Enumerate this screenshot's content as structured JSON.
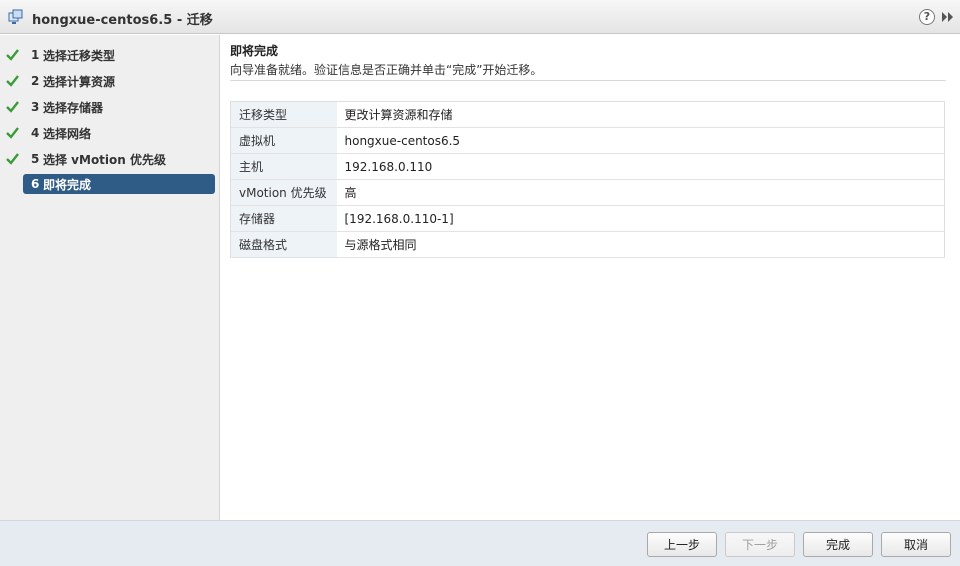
{
  "window": {
    "title": "hongxue-centos6.5 - 迁移",
    "title_icon": "vm-migrate-icon",
    "help_label": "?",
    "help_icon": "help-icon",
    "expand_icon": "double-chevron-right-icon"
  },
  "steps": [
    {
      "num": "1",
      "label": "选择迁移类型",
      "done": true
    },
    {
      "num": "2",
      "label": "选择计算资源",
      "done": true
    },
    {
      "num": "3",
      "label": "选择存储器",
      "done": true
    },
    {
      "num": "4",
      "label": "选择网络",
      "done": true
    },
    {
      "num": "5",
      "label": "选择 vMotion 优先级",
      "done": true
    },
    {
      "num": "6",
      "label": "即将完成",
      "done": false,
      "active": true
    }
  ],
  "content": {
    "title": "即将完成",
    "description": "向导准备就绪。验证信息是否正确并单击“完成”开始迁移。"
  },
  "summary": [
    {
      "key": "迁移类型",
      "value": "更改计算资源和存储"
    },
    {
      "key": "虚拟机",
      "value": "hongxue-centos6.5"
    },
    {
      "key": "主机",
      "value": "192.168.0.110"
    },
    {
      "key": "vMotion 优先级",
      "value": "高"
    },
    {
      "key": "存储器",
      "value": "[192.168.0.110-1]"
    },
    {
      "key": "磁盘格式",
      "value": "与源格式相同"
    }
  ],
  "buttons": {
    "back": "上一步",
    "next": "下一步",
    "finish": "完成",
    "cancel": "取消"
  },
  "colors": {
    "active_step": "#2f5b87",
    "check": "#3a9b3a",
    "key_cell": "#eef3f8"
  }
}
